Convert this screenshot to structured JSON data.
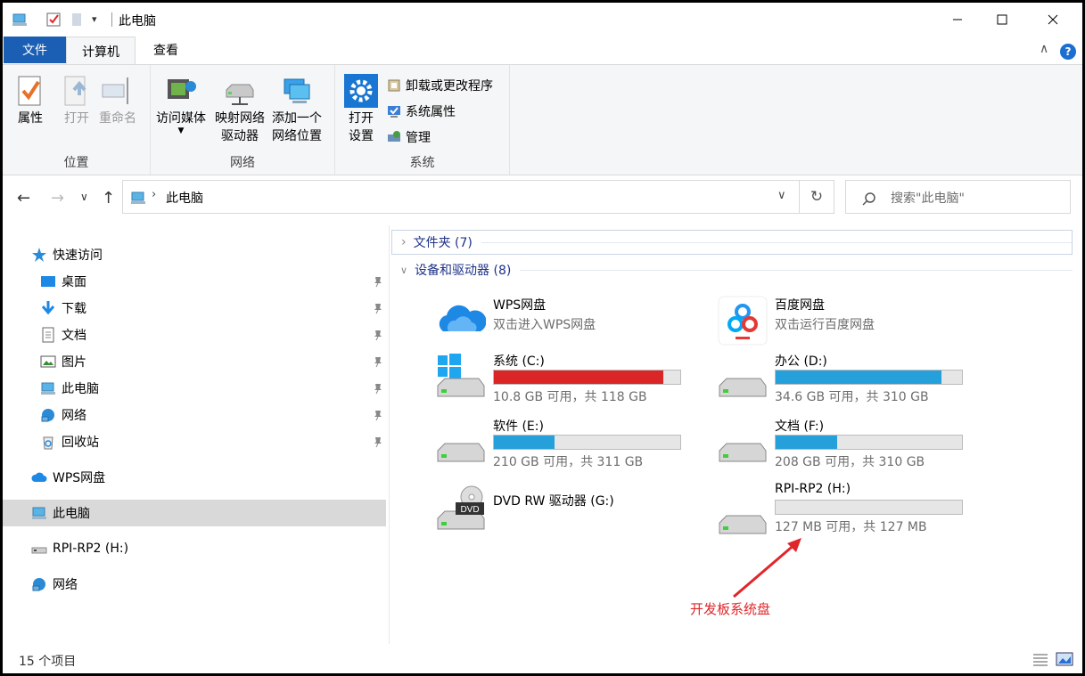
{
  "window": {
    "title": "此电脑"
  },
  "ribbon_tabs": {
    "file": "文件",
    "computer": "计算机",
    "view": "查看"
  },
  "ribbon": {
    "location": {
      "label": "位置",
      "properties": "属性",
      "open": "打开",
      "rename": "重命名"
    },
    "network": {
      "label": "网络",
      "access_media": "访问媒体",
      "map_drive_1": "映射网络",
      "map_drive_2": "驱动器",
      "add_location_1": "添加一个",
      "add_location_2": "网络位置"
    },
    "system": {
      "label": "系统",
      "open_settings_1": "打开",
      "open_settings_2": "设置",
      "uninstall": "卸载或更改程序",
      "sys_props": "系统属性",
      "manage": "管理"
    }
  },
  "address": {
    "path": "此电脑",
    "search_placeholder": "搜索\"此电脑\""
  },
  "sidebar": {
    "quick_access": "快速访问",
    "items": [
      "桌面",
      "下载",
      "文档",
      "图片",
      "此电脑",
      "网络",
      "回收站"
    ],
    "wps": "WPS网盘",
    "this_pc": "此电脑",
    "rpi": "RPI-RP2 (H:)",
    "network": "网络"
  },
  "sections": {
    "folders": "文件夹 (7)",
    "devices": "设备和驱动器 (8)"
  },
  "apps": [
    {
      "name": "WPS网盘",
      "desc": "双击进入WPS网盘"
    },
    {
      "name": "百度网盘",
      "desc": "双击运行百度网盘"
    }
  ],
  "drives": [
    {
      "name": "系统 (C:)",
      "free": "10.8 GB 可用，共 118 GB",
      "used_fraction": 0.908,
      "color": "#da2626"
    },
    {
      "name": "办公 (D:)",
      "free": "34.6 GB 可用，共 310 GB",
      "used_fraction": 0.888,
      "color": "#26a0da"
    },
    {
      "name": "软件 (E:)",
      "free": "210 GB 可用，共 311 GB",
      "used_fraction": 0.325,
      "color": "#26a0da"
    },
    {
      "name": "文档 (F:)",
      "free": "208 GB 可用，共 310 GB",
      "used_fraction": 0.329,
      "color": "#26a0da"
    },
    {
      "name": "RPI-RP2 (H:)",
      "free": "127 MB 可用，共 127 MB",
      "used_fraction": 0.0,
      "color": "#26a0da"
    }
  ],
  "dvd": {
    "name": "DVD RW 驱动器 (G:)",
    "badge": "DVD"
  },
  "annotation": "开发板系统盘",
  "status": {
    "count": "15 个项目"
  }
}
